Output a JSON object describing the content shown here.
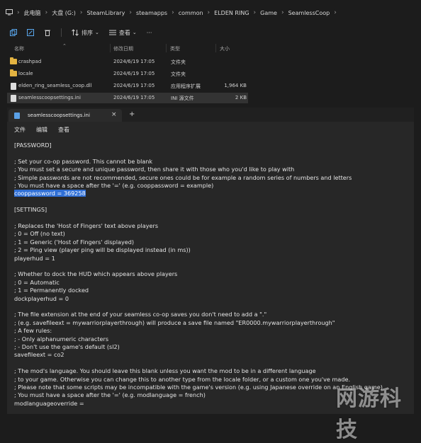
{
  "explorer": {
    "breadcrumbs": [
      "此电脑",
      "大盘 (G:)",
      "SteamLibrary",
      "steamapps",
      "common",
      "ELDEN RING",
      "Game",
      "SeamlessCoop"
    ],
    "toolbar": {
      "sort_label": "排序",
      "view_label": "查看",
      "more_label": "···"
    },
    "columns": {
      "name": "名称",
      "date": "修改日期",
      "type": "类型",
      "size": "大小"
    },
    "files": [
      {
        "name": "crashpad",
        "date": "2024/6/19 17:05",
        "type": "文件夹",
        "size": ""
      },
      {
        "name": "locale",
        "date": "2024/6/19 17:05",
        "type": "文件夹",
        "size": ""
      },
      {
        "name": "elden_ring_seamless_coop.dll",
        "date": "2024/6/19 17:05",
        "type": "应用程序扩展",
        "size": "1,964 KB"
      },
      {
        "name": "seamlesscoopsettings.ini",
        "date": "2024/6/19 17:05",
        "type": "INI 源文件",
        "size": "2 KB"
      }
    ]
  },
  "notepad": {
    "tab_title": "seamlesscoopsettings.ini",
    "close_glyph": "×",
    "new_tab_glyph": "+",
    "menu": {
      "file": "文件",
      "edit": "编辑",
      "view": "查看"
    },
    "lines": [
      "[PASSWORD]",
      "",
      "; Set your co-op password. This cannot be blank",
      "; You must set a secure and unique password, then share it with those who you'd like to play with",
      "; Simple passwords are not recommended, secure ones could be for example a random series of numbers and letters",
      "; You must have a space after the '=' (e.g. cooppassword = example)",
      "cooppassword = 369258",
      "",
      "[SETTINGS]",
      "",
      "; Replaces the 'Host of Fingers' text above players",
      "; 0 = Off (no text)",
      "; 1 = Generic ('Host of Fingers' displayed)",
      "; 2 = Ping view (player ping will be displayed instead (in ms))",
      "playerhud = 1",
      "",
      "; Whether to dock the HUD which appears above players",
      "; 0 = Automatic",
      "; 1 = Permanently docked",
      "dockplayerhud = 0",
      "",
      "; The file extension at the end of your seamless co-op saves you don't need to add a \".\"",
      "; (e.g. savefileext = mywarriorplayerthrough) will produce a save file named \"ER0000.mywarriorplayerthrough\"",
      "; A few rules:",
      "; - Only alphanumeric characters",
      "; - Don't use the game's default (sl2)",
      "savefileext = co2",
      "",
      "; The mod's language. You should leave this blank unless you want the mod to be in a different language",
      "; to your game. Otherwise you can change this to another type from the locale folder, or a custom one you've made.",
      "; Please note that some scripts may be incompatible with the game's version (e.g. using Japanese override on an English game)",
      "; You must have a space after the '=' (e.g. modlanguage = french)",
      "modlanguageoverride ="
    ],
    "selected_line_index": 6
  },
  "watermark": "网游科技",
  "colors": {
    "folder": "#e3b341",
    "selection": "#2f6fd6",
    "editor_bg": "#272727"
  }
}
